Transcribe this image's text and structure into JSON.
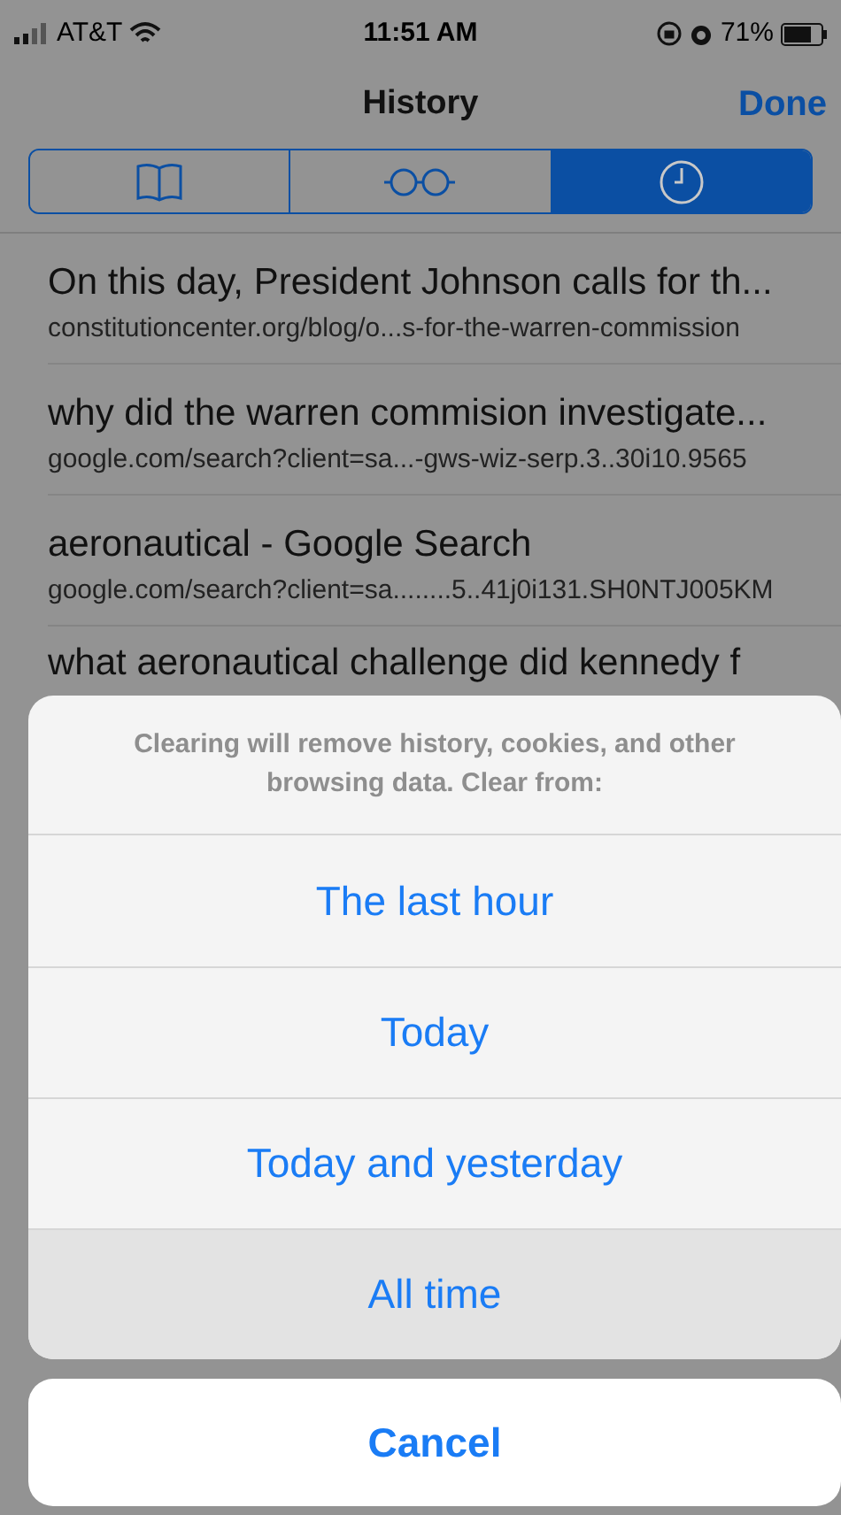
{
  "status_bar": {
    "carrier": "AT&T",
    "time": "11:51 AM",
    "battery": "71%"
  },
  "nav": {
    "title": "History",
    "done": "Done"
  },
  "tabs": [
    {
      "kind": "bookmarks",
      "selected": false
    },
    {
      "kind": "reading-list",
      "selected": false
    },
    {
      "kind": "history",
      "selected": true
    }
  ],
  "history": [
    {
      "title": "On this day, President Johnson calls for th...",
      "url": "constitutioncenter.org/blog/o...s-for-the-warren-commission"
    },
    {
      "title": "why did the warren commision investigate...",
      "url": "google.com/search?client=sa...-gws-wiz-serp.3..30i10.9565"
    },
    {
      "title": "aeronautical - Google Search",
      "url": "google.com/search?client=sa........5..41j0i131.SH0NTJ005KM"
    },
    {
      "title": "what aeronautical challenge did kennedy f"
    }
  ],
  "action_sheet": {
    "message": "Clearing will remove history, cookies, and other browsing data. Clear from:",
    "options": [
      {
        "label": "The last hour",
        "highlighted": false
      },
      {
        "label": "Today",
        "highlighted": false
      },
      {
        "label": "Today and yesterday",
        "highlighted": false
      },
      {
        "label": "All time",
        "highlighted": true
      }
    ],
    "cancel": "Cancel"
  }
}
